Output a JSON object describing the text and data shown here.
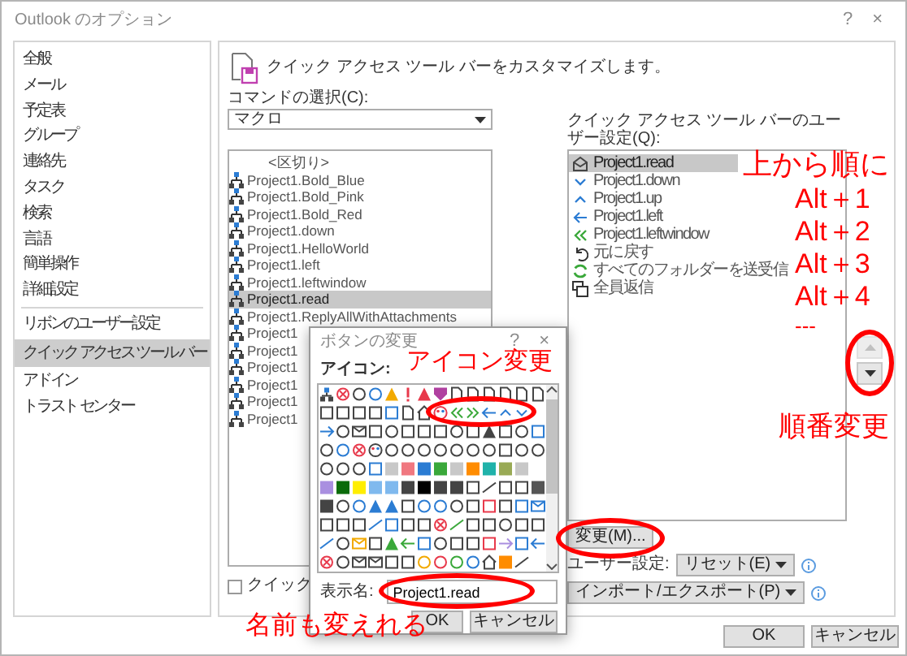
{
  "window": {
    "title": "Outlook のオプション",
    "help": "?",
    "close": "×"
  },
  "sidebar": {
    "groups": [
      {
        "items": [
          {
            "label": "全般",
            "selected": false
          },
          {
            "label": "メール",
            "selected": false
          },
          {
            "label": "予定表",
            "selected": false
          },
          {
            "label": "グループ",
            "selected": false
          },
          {
            "label": "連絡先",
            "selected": false
          },
          {
            "label": "タスク",
            "selected": false
          },
          {
            "label": "検索",
            "selected": false
          },
          {
            "label": "言語",
            "selected": false
          },
          {
            "label": "簡単操作",
            "selected": false
          },
          {
            "label": "詳細設定",
            "selected": false
          }
        ]
      },
      {
        "items": [
          {
            "label": "リボンのユーザー設定",
            "selected": false
          },
          {
            "label": "クイック アクセス ツール バー",
            "selected": true
          },
          {
            "label": "アドイン",
            "selected": false
          },
          {
            "label": "トラスト センター",
            "selected": false
          }
        ]
      }
    ]
  },
  "header": {
    "title": "クイック アクセス ツール バーをカスタマイズします。"
  },
  "commands": {
    "label": "コマンドの選択(C):",
    "value": "マクロ",
    "items": [
      {
        "kind": "separator",
        "label": "<区切り>",
        "selected": false
      },
      {
        "kind": "macro",
        "label": "Project1.Bold_Blue",
        "selected": false
      },
      {
        "kind": "macro",
        "label": "Project1.Bold_Pink",
        "selected": false
      },
      {
        "kind": "macro",
        "label": "Project1.Bold_Red",
        "selected": false
      },
      {
        "kind": "macro",
        "label": "Project1.down",
        "selected": false
      },
      {
        "kind": "macro",
        "label": "Project1.HelloWorld",
        "selected": false
      },
      {
        "kind": "macro",
        "label": "Project1.left",
        "selected": false
      },
      {
        "kind": "macro",
        "label": "Project1.leftwindow",
        "selected": false
      },
      {
        "kind": "macro",
        "label": "Project1.read",
        "selected": true
      },
      {
        "kind": "macro",
        "label": "Project1.ReplyAllWithAttachments",
        "selected": false
      },
      {
        "kind": "macro",
        "label": "Project1",
        "selected": false
      },
      {
        "kind": "macro",
        "label": "Project1",
        "selected": false
      },
      {
        "kind": "macro",
        "label": "Project1",
        "selected": false
      },
      {
        "kind": "macro",
        "label": "Project1",
        "selected": false
      },
      {
        "kind": "macro",
        "label": "Project1",
        "selected": false
      },
      {
        "kind": "macro",
        "label": "Project1",
        "selected": false
      }
    ]
  },
  "show_below": {
    "label": "クイック",
    "checked": false
  },
  "toolbar": {
    "label": "クイック アクセス ツール バーのユーザー設定(Q):",
    "items": [
      {
        "label": "Project1.read",
        "selected": true
      },
      {
        "label": "Project1.down",
        "selected": false
      },
      {
        "label": "Project1.up",
        "selected": false
      },
      {
        "label": "Project1.left",
        "selected": false
      },
      {
        "label": "Project1.leftwindow",
        "selected": false
      },
      {
        "label": "元に戻す",
        "selected": false
      },
      {
        "label": "すべてのフォルダーを送受信",
        "selected": false
      },
      {
        "label": "全員返信",
        "selected": false
      }
    ],
    "move_up": {
      "disabled": true
    },
    "move_down": {
      "disabled": false
    },
    "modify_button": "変更(M)...",
    "customizations_label": "ユーザー設定:",
    "reset_button": "リセット(E)",
    "import_export_button": "インポート/エクスポート(P)"
  },
  "dialog": {
    "title": "ボタンの変更",
    "help": "?",
    "close": "×",
    "icons_label": "アイコン:",
    "display_name_label": "表示名:",
    "display_name": "Project1.read",
    "ok": "OK",
    "cancel": "キャンセル"
  },
  "buttons": {
    "ok": "OK",
    "cancel": "キャンセル"
  },
  "annotations": [
    {
      "text": "上から順に"
    },
    {
      "text": "Alt＋1"
    },
    {
      "text": "Alt＋2"
    },
    {
      "text": "Alt＋3"
    },
    {
      "text": "Alt＋4"
    },
    {
      "text": "---"
    },
    {
      "text": "アイコン変更"
    },
    {
      "text": "順番変更"
    },
    {
      "text": "名前も変えれる"
    }
  ]
}
